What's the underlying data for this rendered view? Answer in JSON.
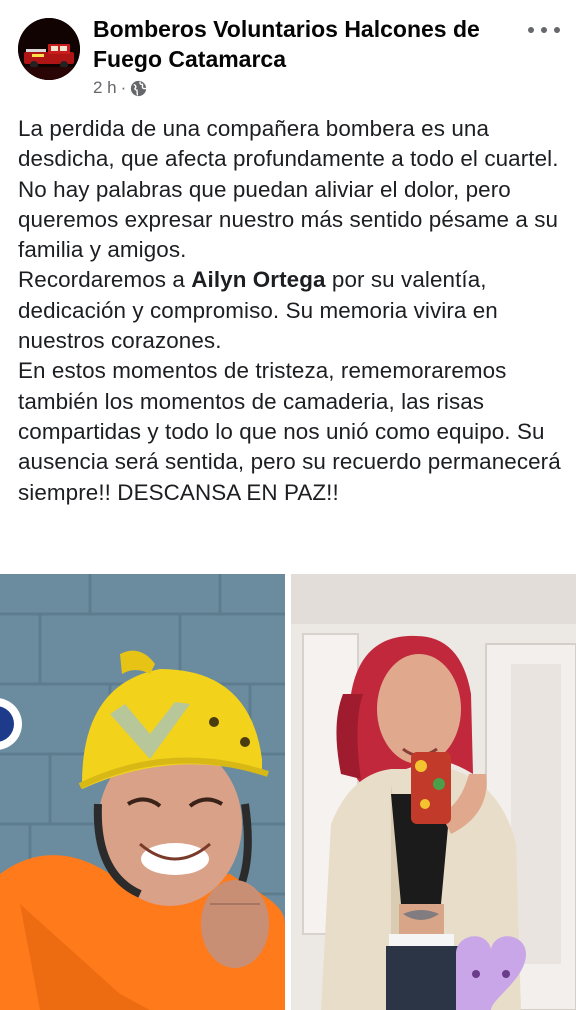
{
  "post": {
    "author": "Bomberos Voluntarios Halcones de Fuego Catamarca",
    "time": "2 h",
    "separator": "·",
    "privacy_icon": "globe-icon",
    "more_icon": "more-horizontal-icon",
    "text": {
      "p1": "La perdida de una compañera bombera es una desdicha, que afecta profundamente a todo el cuartel. No hay palabras que puedan aliviar el dolor, pero queremos expresar nuestro más sentido pésame a su familia y amigos.",
      "p2_before": "Recordaremos a ",
      "p2_bold": "Ailyn Ortega",
      "p2_after": " por su valentía, dedicación y compromiso. Su memoria vivira en nuestros corazones.",
      "p3": "En estos momentos de tristeza, rememoraremos también los momentos de camaderia, las risas compartidas y todo lo que nos unió como equipo. Su ausencia será sentida, pero su recuerdo permanecerá siempre!! DESCANSA EN PAZ!!"
    }
  },
  "colors": {
    "text": "#1c1e21",
    "meta": "#65676b",
    "helmet": "#f2d21b",
    "uniform": "#ff7a1a",
    "hair": "#c2283b"
  }
}
